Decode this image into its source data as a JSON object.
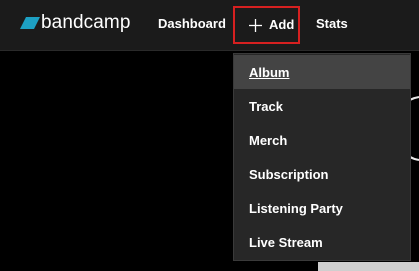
{
  "brand": {
    "logo_text": "bandcamp",
    "accent": "#1da0c3"
  },
  "nav": {
    "dashboard_label": "Dashboard",
    "add_label": "Add",
    "stats_label": "Stats",
    "highlight_color": "#d62020"
  },
  "add_menu": {
    "items": [
      {
        "label": "Album",
        "active": true
      },
      {
        "label": "Track"
      },
      {
        "label": "Merch"
      },
      {
        "label": "Subscription"
      },
      {
        "label": "Listening Party"
      },
      {
        "label": "Live Stream"
      }
    ]
  }
}
